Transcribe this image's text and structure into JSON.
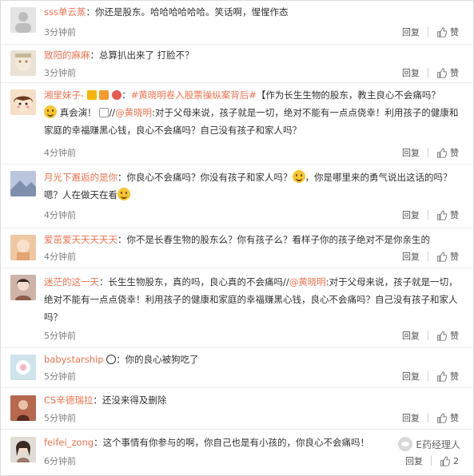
{
  "ui": {
    "reply": "回复",
    "like": "赞"
  },
  "comments": [
    {
      "user": "sss单云蒸",
      "sep": "：",
      "text": "你还是股东。哈哈哈哈哈哈。笑话啊，惺惺作态",
      "time": "3分钟前"
    },
    {
      "user": "致阳的麻麻",
      "sep": "：",
      "text": "总算扒出来了 打脸不？",
      "time": "3分钟前"
    },
    {
      "user": "湘里妹子-",
      "p1": "：",
      "hashtag": "#黄晓明卷入股票操纵案背后#",
      "p2": "【作为长生生物的股东，教主良心不会痛吗？",
      "p3": "真会演！",
      "p4": "//",
      "mention": "@黄晓明",
      "p5": ":对于父母来说，孩子就是一切，绝对不能有一点点侥幸！利用孩子的健康和家庭的幸福赚黑心钱，良心不会痛吗？自己没有孩子和家人吗？",
      "time": "4分钟前"
    },
    {
      "user": "月光下邂逅的是你",
      "p1": "：你良心不会痛吗？你没有孩子和家人吗？",
      "p2": "，你是哪里来的勇气说出这话的吗？嗯？人在做天在看",
      "time": "4分钟前"
    },
    {
      "user": "爱茁爱天天天天天",
      "sep": "：",
      "text": "你不是长春生物的股东么？你有孩子么？看样子你的孩子绝对不是你亲生的",
      "time": "4分钟前"
    },
    {
      "user": "迷茫的这一天",
      "p1": "：长生生物股东，真的吗，良心真的不会痛吗//",
      "mention": "@黄晓明",
      "p2": ":对于父母来说，孩子就是一切，绝对不能有一点点侥幸！利用孩子的健康和家庭的幸福赚黑心钱，良心不会痛吗？自己没有孩子和家人吗？",
      "time": "5分钟前"
    },
    {
      "user": "babystarship",
      "p1": "：你的良心被狗吃了",
      "time": "5分钟前"
    },
    {
      "user": "CS辛德瑞拉",
      "sep": "：",
      "text": "还没来得及删除",
      "time": "5分钟前"
    },
    {
      "user": "feifei_zong",
      "sep": "：",
      "text": "这个事情有你参与的啊，你自己也是有小孩的，你良心不会痛吗！",
      "time": "6分钟前",
      "likes": "2"
    }
  ],
  "watermark": {
    "text": "E药经理人"
  },
  "colors": {
    "username": "#eb7350",
    "text": "#333333",
    "time": "#808080"
  }
}
